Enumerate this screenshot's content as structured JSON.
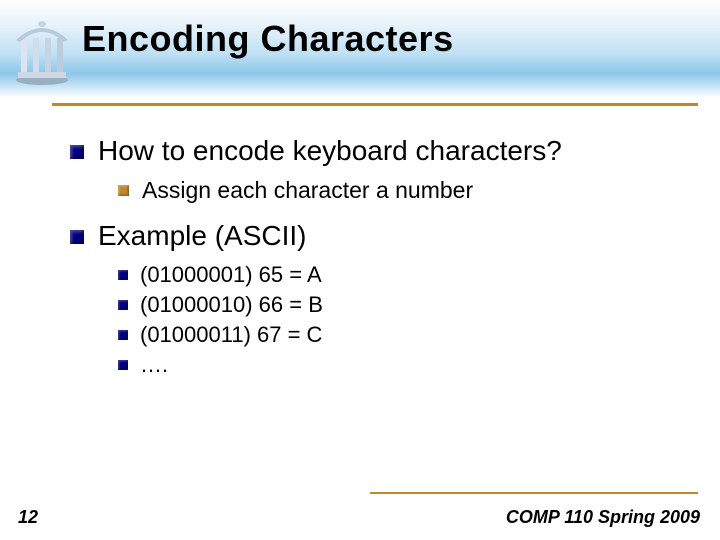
{
  "title": "Encoding Characters",
  "bullets": {
    "b1": "How to encode keyboard characters?",
    "b1_1": "Assign each character a number",
    "b2": "Example (ASCII)",
    "b2_1": "(01000001) 65 = A",
    "b2_2": "(01000010) 66 = B",
    "b2_3": "(01000011) 67 = C",
    "b2_4": "…."
  },
  "footer": {
    "page": "12",
    "course": "COMP 110 Spring 2009"
  }
}
